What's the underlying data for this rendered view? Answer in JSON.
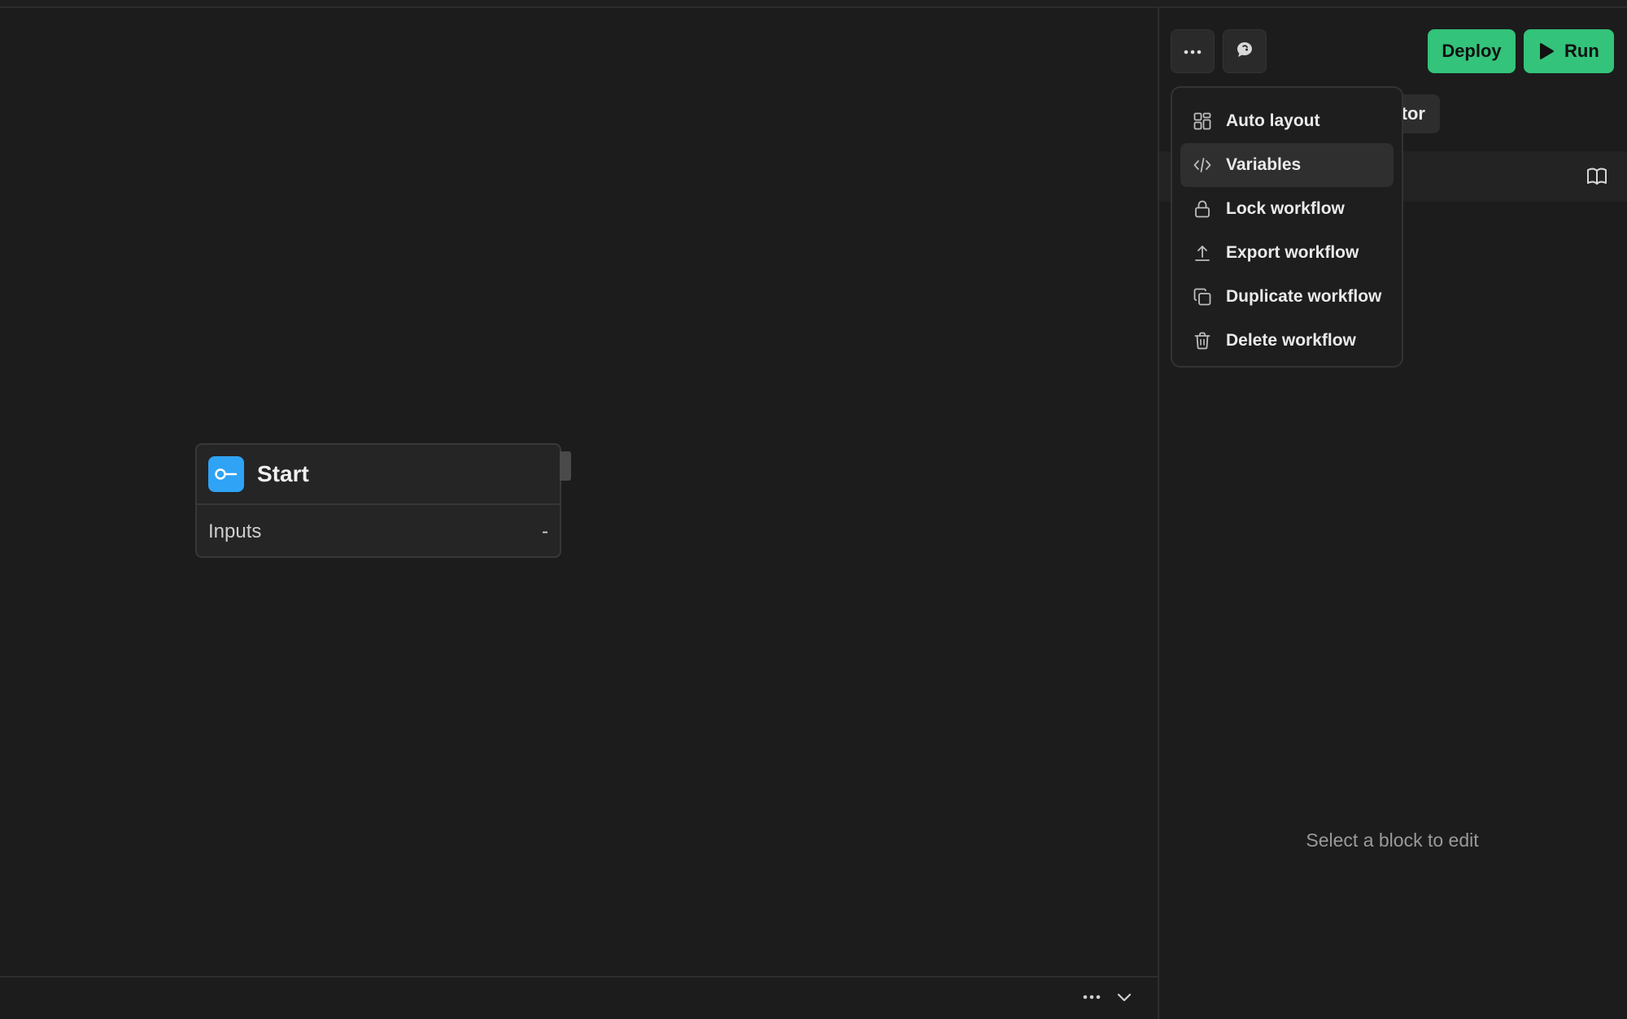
{
  "toolbar": {
    "more_icon": "more-horizontal-icon",
    "chat_icon": "chat-bubble-icon",
    "deploy_label": "Deploy",
    "run_label": "Run",
    "run_icon": "play-icon",
    "accent_color": "#33c37a"
  },
  "menu": {
    "items": [
      {
        "label": "Auto layout",
        "icon": "layout-grid-icon"
      },
      {
        "label": "Variables",
        "icon": "code-icon"
      },
      {
        "label": "Lock workflow",
        "icon": "lock-icon"
      },
      {
        "label": "Export workflow",
        "icon": "upload-icon"
      },
      {
        "label": "Duplicate workflow",
        "icon": "copy-icon"
      },
      {
        "label": "Delete workflow",
        "icon": "trash-icon"
      }
    ]
  },
  "panel": {
    "chip_text": "tor",
    "doc_icon": "book-open-icon",
    "empty_message": "Select a block to edit"
  },
  "node": {
    "title": "Start",
    "icon": "key-icon",
    "icon_color": "#2fa3f5",
    "inputs_label": "Inputs",
    "inputs_value": "-"
  },
  "bottom": {
    "more_icon": "more-horizontal-icon",
    "collapse_icon": "chevron-down-icon"
  }
}
